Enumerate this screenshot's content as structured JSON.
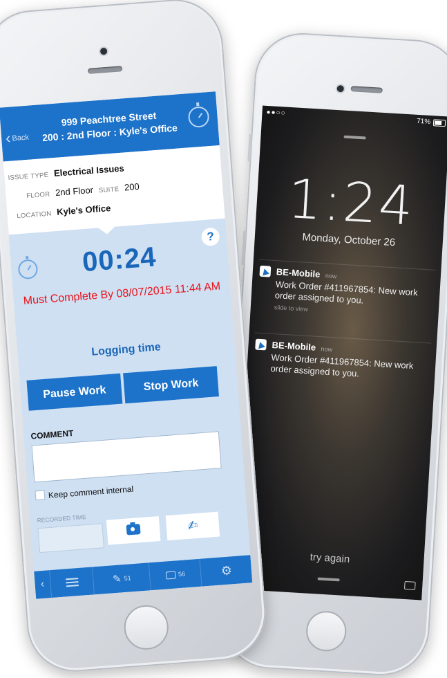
{
  "lock_screen": {
    "status_carrier": "●●○○",
    "battery_percent": "71%",
    "time": "1:24",
    "date": "Monday, October 26",
    "notifications": [
      {
        "app": "BE-Mobile",
        "when": "now",
        "message": "Work Order #411967854: New work order assigned to you.",
        "hint": "slide to view"
      },
      {
        "app": "BE-Mobile",
        "when": "now",
        "message": "Work Order #411967854: New work order assigned to you.",
        "hint": ""
      }
    ],
    "try_again": "try again"
  },
  "app": {
    "header": {
      "back_label": "Back",
      "back_glyph": "‹",
      "line1": "999 Peachtree Street",
      "line2": "200 : 2nd Floor : Kyle's Office"
    },
    "info": {
      "issue_type_label": "ISSUE TYPE",
      "issue_type_value": "Electrical Issues",
      "floor_label": "FLOOR",
      "floor_value": "2nd Floor",
      "suite_label": "SUITE",
      "suite_value": "200",
      "location_label": "LOCATION",
      "location_value": "Kyle's Office"
    },
    "help_glyph": "?",
    "timer": "00:24",
    "deadline": "Must Complete By 08/07/2015 11:44 AM",
    "logging_status": "Logging time",
    "pause_label": "Pause Work",
    "stop_label": "Stop Work",
    "comment_label": "COMMENT",
    "keep_internal_label": "Keep comment internal",
    "recorded_time_label": "RECORDED TIME",
    "tabbar": {
      "pin_count": "51",
      "chat_count": "56"
    },
    "accent_color": "#1d72c9",
    "deadline_color": "#e8131b"
  }
}
